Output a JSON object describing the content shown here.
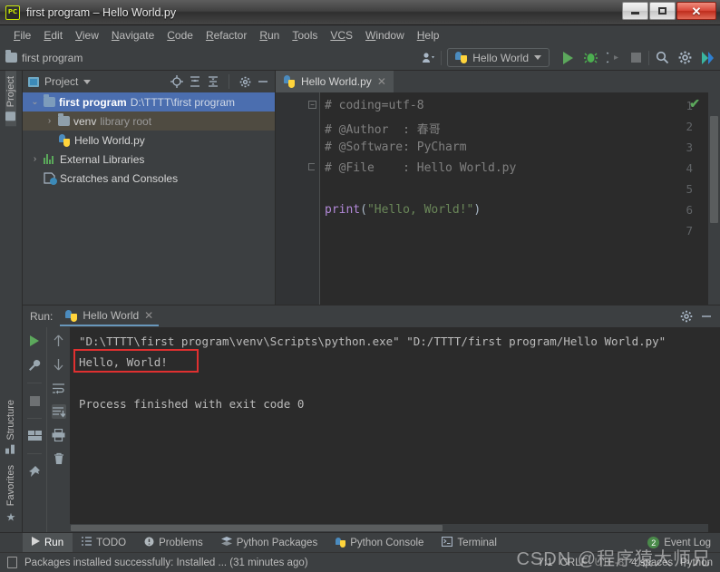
{
  "window": {
    "title": "first program – Hello World.py",
    "app_icon": "pycharm-icon",
    "buttons": {
      "minimize": "–",
      "maximize": "❐",
      "close": "✕"
    }
  },
  "menubar": {
    "items": [
      {
        "mnemonic": "F",
        "rest": "ile"
      },
      {
        "mnemonic": "E",
        "rest": "dit"
      },
      {
        "mnemonic": "V",
        "rest": "iew"
      },
      {
        "mnemonic": "N",
        "rest": "avigate"
      },
      {
        "mnemonic": "C",
        "rest": "ode"
      },
      {
        "mnemonic": "R",
        "rest": "efactor"
      },
      {
        "mnemonic": "R",
        "rest": "un"
      },
      {
        "mnemonic": "T",
        "rest": "ools"
      },
      {
        "mnemonic": "VC",
        "rest": "S"
      },
      {
        "mnemonic": "W",
        "rest": "indow"
      },
      {
        "mnemonic": "H",
        "rest": "elp"
      }
    ]
  },
  "toolbar": {
    "breadcrumb": "first program",
    "run_config": "Hello World",
    "icons": [
      "user-icon",
      "run-icon",
      "debug-icon",
      "coverage-icon",
      "stop-icon",
      "search-icon",
      "settings-icon",
      "updates-icon"
    ]
  },
  "left_stripe": {
    "top_tabs": [
      {
        "label": "Project",
        "active": true
      }
    ],
    "bottom_tabs": [
      {
        "label": "Structure",
        "active": false
      },
      {
        "label": "Favorites",
        "active": false
      }
    ]
  },
  "project_panel": {
    "header": {
      "title": "Project",
      "icons": [
        "locate-icon",
        "expand-all-icon",
        "collapse-all-icon",
        "gear-icon",
        "minimize-icon"
      ]
    },
    "tree": [
      {
        "name": "first program",
        "detail": "D:\\TTTT\\first program",
        "icon": "folder-icon",
        "arrow": "⌄",
        "state": "selected",
        "indent": 0
      },
      {
        "name": "venv",
        "detail": "library root",
        "icon": "folder-icon",
        "arrow": "›",
        "state": "highlight",
        "indent": 1
      },
      {
        "name": "Hello World.py",
        "detail": "",
        "icon": "python-file-icon",
        "arrow": "",
        "state": "",
        "indent": 2
      },
      {
        "name": "External Libraries",
        "detail": "",
        "icon": "libraries-icon",
        "arrow": "›",
        "state": "",
        "indent": 0
      },
      {
        "name": "Scratches and Consoles",
        "detail": "",
        "icon": "scratches-icon",
        "arrow": "",
        "state": "",
        "indent": 1
      }
    ]
  },
  "editor": {
    "tab": {
      "label": "Hello World.py",
      "icon": "python-file-icon",
      "close": "✕"
    },
    "inspection_status": "✔",
    "lines": [
      {
        "num": "1",
        "fold": "−",
        "segments": [
          {
            "cls": "c-comment",
            "text": "# coding=utf-8"
          }
        ]
      },
      {
        "num": "2",
        "fold": "",
        "segments": [
          {
            "cls": "c-comment",
            "text": "# @Author  : 春哥"
          }
        ]
      },
      {
        "num": "3",
        "fold": "",
        "segments": [
          {
            "cls": "c-comment",
            "text": "# @Software: PyCharm"
          }
        ]
      },
      {
        "num": "4",
        "fold": "⌐",
        "segments": [
          {
            "cls": "c-comment",
            "text": "# @File    : Hello World.py"
          }
        ]
      },
      {
        "num": "5",
        "fold": "",
        "segments": []
      },
      {
        "num": "6",
        "fold": "",
        "segments": [
          {
            "cls": "c-fn",
            "text": "print"
          },
          {
            "cls": "c-paren",
            "text": "("
          },
          {
            "cls": "c-str",
            "text": "\"Hello, World!\""
          },
          {
            "cls": "c-paren",
            "text": ")"
          }
        ]
      },
      {
        "num": "7",
        "fold": "",
        "segments": []
      }
    ]
  },
  "run_panel": {
    "label": "Run:",
    "tab": {
      "label": "Hello World",
      "icon": "python-icon",
      "close": "✕"
    },
    "header_icons": [
      "settings-icon",
      "minimize-icon"
    ],
    "left_tools": [
      "rerun-icon",
      "wrench-icon",
      "stop-icon",
      "layout-icon",
      "pin-icon"
    ],
    "right_tools": [
      "up-arrow-icon",
      "down-arrow-icon",
      "soft-wrap-icon",
      "scroll-to-end-icon",
      "print-icon",
      "trash-icon"
    ],
    "console": [
      "\"D:\\TTTT\\first program\\venv\\Scripts\\python.exe\" \"D:/TTTT/first program/Hello World.py\"",
      "Hello, World!",
      "",
      "Process finished with exit code 0"
    ],
    "highlight_text": "Hello, World!",
    "highlight_color": "#e03030"
  },
  "tool_window_bar": {
    "items": [
      {
        "label": "Run",
        "icon": "run-icon",
        "active": true
      },
      {
        "label": "TODO",
        "icon": "todo-icon",
        "active": false
      },
      {
        "label": "Problems",
        "icon": "problems-icon",
        "active": false
      },
      {
        "label": "Python Packages",
        "icon": "packages-icon",
        "active": false
      },
      {
        "label": "Python Console",
        "icon": "python-console-icon",
        "active": false
      },
      {
        "label": "Terminal",
        "icon": "terminal-icon",
        "active": false
      }
    ],
    "event_log": {
      "label": "Event Log",
      "count": "2",
      "badge_color": "#4a8a4a"
    }
  },
  "status_bar": {
    "message": "Packages installed successfully: Installed ... (31 minutes ago)",
    "caret": "7:1",
    "line_sep": "CRLF",
    "encoding": "UTF-8",
    "indent": "4 spaces",
    "branch": "Python"
  },
  "watermark": "CSDN @程序猿大师兄"
}
